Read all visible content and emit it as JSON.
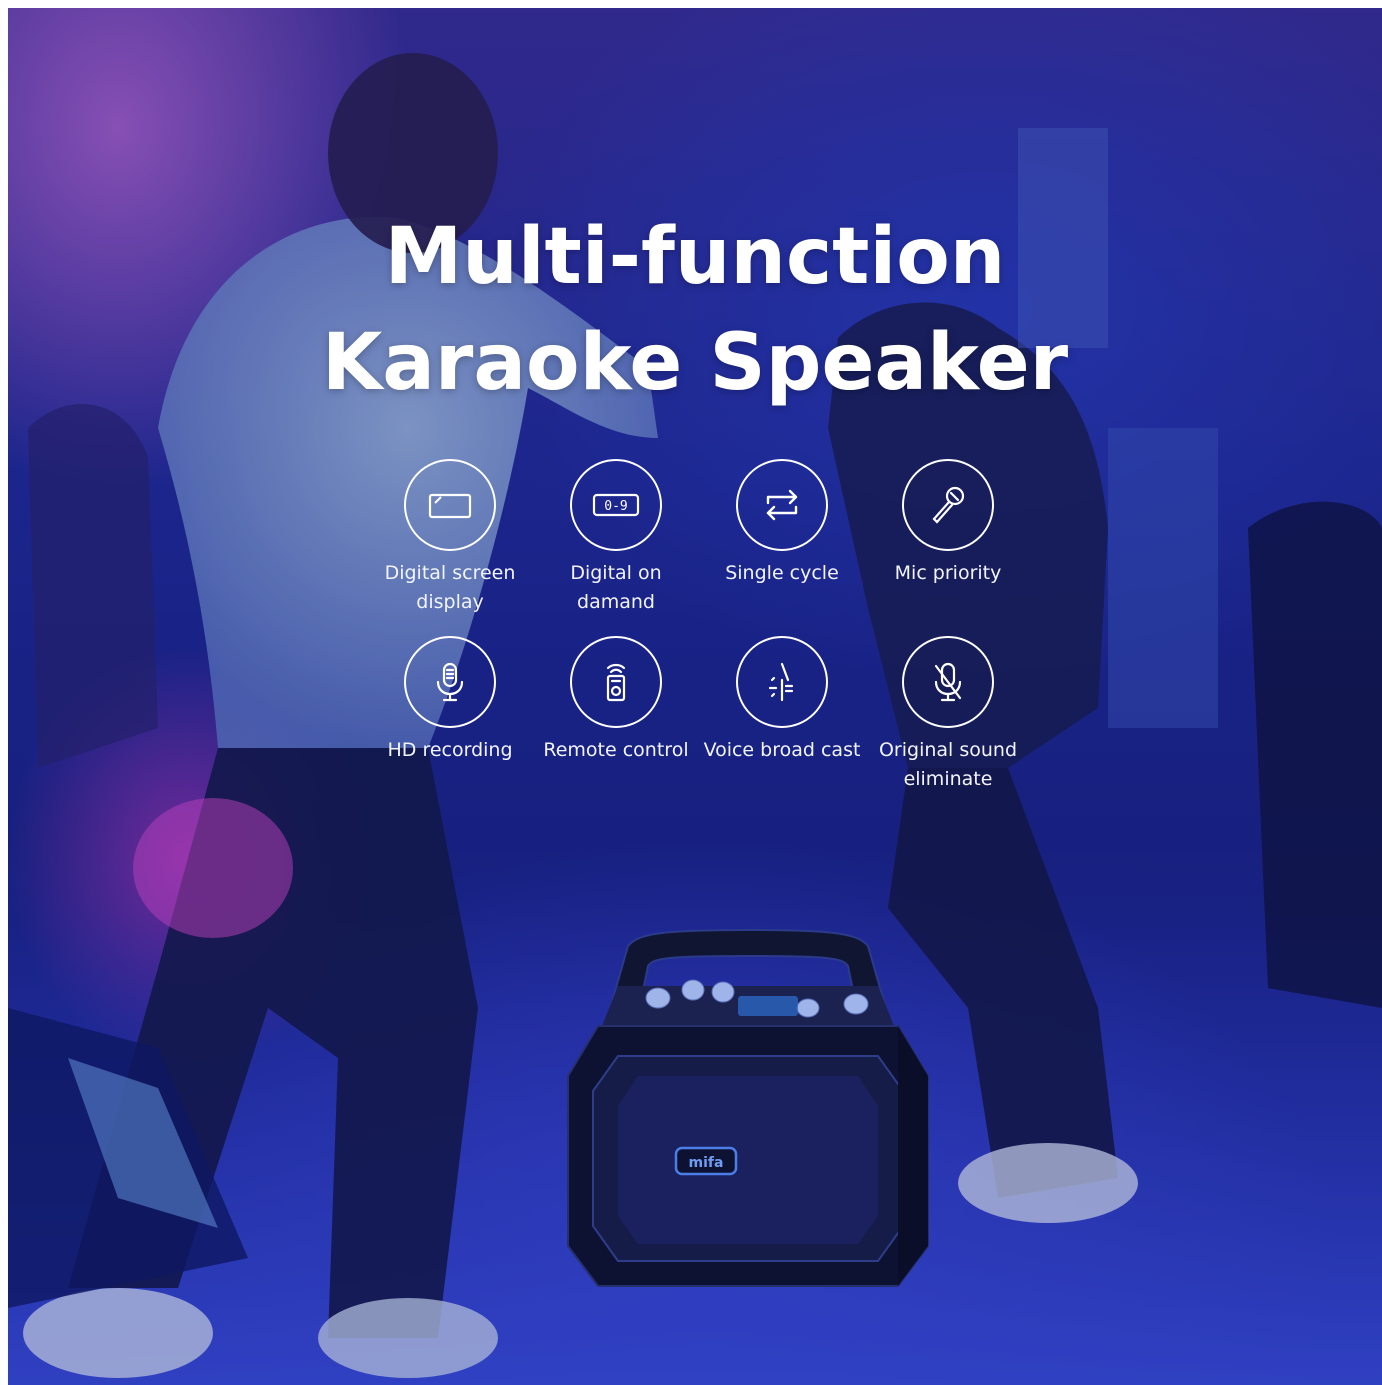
{
  "headline": {
    "line1": "Multi-function",
    "line2": "Karaoke Speaker"
  },
  "features": [
    {
      "icon": "digital-screen-icon",
      "label_line1": "Digital screen",
      "label_line2": "display"
    },
    {
      "icon": "digital-numbers-icon",
      "label_line1": "Digital on",
      "label_line2": "damand",
      "icon_text": "0-9"
    },
    {
      "icon": "repeat-icon",
      "label_line1": "Single cycle",
      "label_line2": ""
    },
    {
      "icon": "microphone-icon",
      "label_line1": "Mic priority",
      "label_line2": ""
    },
    {
      "icon": "recording-mic-icon",
      "label_line1": "HD recording",
      "label_line2": ""
    },
    {
      "icon": "remote-control-icon",
      "label_line1": "Remote control",
      "label_line2": ""
    },
    {
      "icon": "voice-broadcast-icon",
      "label_line1": "Voice broad cast",
      "label_line2": ""
    },
    {
      "icon": "muted-mic-icon",
      "label_line1": "Original sound",
      "label_line2": "eliminate"
    }
  ],
  "product": {
    "brand_logo": "mifa"
  },
  "colors": {
    "text": "#ffffff",
    "background_dominant": "#1f2a9a",
    "accent_pink": "#d66ad8"
  }
}
